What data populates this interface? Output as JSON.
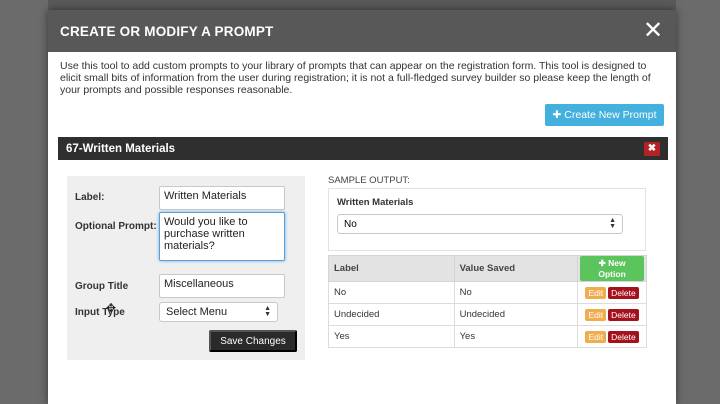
{
  "modal": {
    "title": "CREATE OR MODIFY A PROMPT",
    "close_glyph": "✕",
    "intro": "Use this tool to add custom prompts to your library of prompts that can appear on the registration form. This tool is designed to elicit small bits of information from the user during registration; it is not a full-fledged survey builder so please keep the length of your prompts and possible responses reasonable."
  },
  "toolbar": {
    "create_label": "Create New Prompt"
  },
  "section": {
    "title": "67-Written Materials",
    "remove_glyph": "✖"
  },
  "form": {
    "label_label": "Label:",
    "label_value": "Written Materials",
    "optional_prompt_label": "Optional Prompt:",
    "optional_prompt_value": "Would you like to purchase written materials?",
    "group_title_label": "Group Title",
    "group_title_value": "Miscellaneous",
    "input_type_label": "Input Type",
    "input_type_value": "Select Menu",
    "save_label": "Save Changes"
  },
  "sample": {
    "heading": "SAMPLE OUTPUT:",
    "question": "Written Materials",
    "selected": "No"
  },
  "options_table": {
    "headers": [
      "Label",
      "Value Saved"
    ],
    "new_option_label": "New Option",
    "edit_label": "Edit",
    "delete_label": "Delete",
    "rows": [
      {
        "label": "No",
        "value": "No"
      },
      {
        "label": "Undecided",
        "value": "Undecided"
      },
      {
        "label": "Yes",
        "value": "Yes"
      }
    ]
  },
  "colors": {
    "header_bg": "#585858",
    "create_btn": "#44b0de",
    "new_option": "#5cc45c",
    "edit": "#f0ad4e",
    "delete": "#a4101b"
  }
}
